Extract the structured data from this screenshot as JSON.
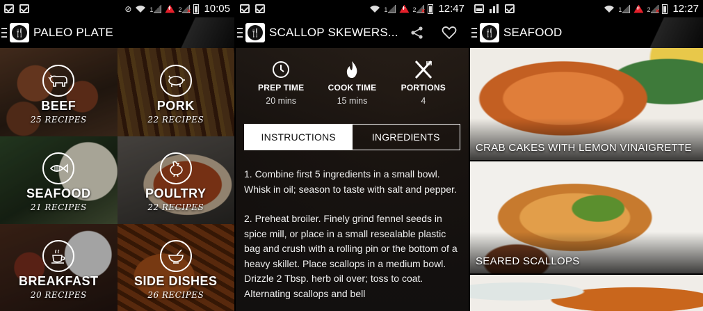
{
  "screens": {
    "categories": {
      "status": {
        "time": "10:05"
      },
      "title": "PALEO PLATE",
      "tiles": [
        {
          "title": "BEEF",
          "count": "25 RECIPES",
          "icon": "cow-icon"
        },
        {
          "title": "PORK",
          "count": "22 RECIPES",
          "icon": "pig-icon"
        },
        {
          "title": "SEAFOOD",
          "count": "21 RECIPES",
          "icon": "fish-icon"
        },
        {
          "title": "POULTRY",
          "count": "22 RECIPES",
          "icon": "chicken-icon"
        },
        {
          "title": "BREAKFAST",
          "count": "20 RECIPES",
          "icon": "coffee-cup-icon"
        },
        {
          "title": "SIDE DISHES",
          "count": "26 RECIPES",
          "icon": "bowl-icon"
        }
      ]
    },
    "recipe": {
      "status": {
        "time": "12:47"
      },
      "title": "SCALLOP SKEWERS...",
      "stats": [
        {
          "label": "PREP TIME",
          "value": "20 mins",
          "icon": "clock-icon"
        },
        {
          "label": "COOK TIME",
          "value": "15 mins",
          "icon": "flame-icon"
        },
        {
          "label": "PORTIONS",
          "value": "4",
          "icon": "fork-knife-icon"
        }
      ],
      "tabs": {
        "instructions": "INSTRUCTIONS",
        "ingredients": "INGREDIENTS",
        "active": "instructions"
      },
      "steps": [
        "1. Combine first 5 ingredients in a small bowl. Whisk in oil; season to taste with salt and pepper.",
        "2. Preheat broiler. Finely grind fennel seeds in spice mill, or place in a small resealable plastic bag and crush with a rolling pin or the bottom of a heavy skillet. Place scallops in a medium bowl. Drizzle 2 Tbsp. herb oil over; toss to coat. Alternating scallops and bell"
      ]
    },
    "seafood": {
      "status": {
        "time": "12:27"
      },
      "title": "SEAFOOD",
      "recipes": [
        {
          "name": "CRAB CAKES WITH LEMON VINAIGRETTE"
        },
        {
          "name": "SEARED SCALLOPS"
        }
      ]
    }
  },
  "colors": {
    "bar": "#000000",
    "accent_red": "#e5202b",
    "tab_active_bg": "#ffffff"
  }
}
